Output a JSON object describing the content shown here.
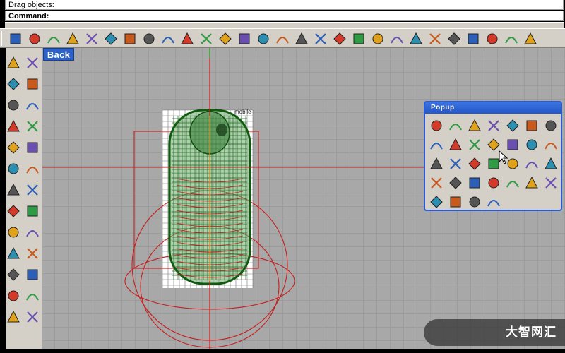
{
  "command_area": {
    "prompt_line": "Drag objects:",
    "command_label": "Command:"
  },
  "viewport": {
    "back_label": "Back",
    "model_label": "mobile-"
  },
  "popup": {
    "title": "Popup"
  },
  "watermark": {
    "text": "大智网汇"
  },
  "colors": {
    "viewport_bg": "#a8a8a8",
    "grid_line": "#9c9c9c",
    "wireframe": "#1f6b1f",
    "red_curve": "#c81e1e",
    "axis_green": "#2fae2f",
    "popup_title": "#2a5bd7"
  },
  "main_toolbar_icons": [
    "new-icon",
    "open-icon",
    "save-icon",
    "print-icon",
    "copy-icon",
    "cut-icon",
    "paste-icon",
    "clipboard-icon",
    "undo-icon",
    "pan-icon",
    "rotate-icon",
    "zoom-icon",
    "zoom-window-icon",
    "zoom-extents-icon",
    "zoom-selected-icon",
    "redo-view-icon",
    "four-viewports-icon",
    "car-icon",
    "grid-icon",
    "snap-icon",
    "points-icon",
    "light-icon",
    "lock-icon",
    "layer-icon",
    "color-wheel-icon",
    "sphere-wire-icon",
    "sphere-shaded-icon",
    "render-icon"
  ],
  "left_toolbar_icons": [
    "select-icon",
    "point-icon",
    "polyline-icon",
    "curve-icon",
    "circle-icon",
    "ellipse-icon",
    "arc-icon",
    "rectangle-icon",
    "polygon-icon",
    "spline-icon",
    "box-icon",
    "surface-icon",
    "solid-icon",
    "sweep-icon",
    "transform-icon",
    "explode-icon",
    "boolean-icon",
    "trim-icon",
    "fillet-icon",
    "offset-icon",
    "text-icon",
    "dimension-icon",
    "array-icon",
    "group-icon",
    "block-icon",
    "analyze-icon"
  ],
  "popup_icons": [
    "light-icon",
    "rect-icon",
    "arc-icon",
    "zoom-icon",
    "grid-sphere-icon",
    "sphere-icon",
    "color-wheel-icon",
    "explode-icon",
    "lightning-icon",
    "curve-icon",
    "polyline-icon",
    "walk-icon",
    "solid-icon",
    "sweep-icon",
    "points-icon",
    "diamond-icon",
    "surface-icon",
    "patch-icon",
    "cap-icon",
    "loft-icon",
    "sweep2-icon",
    "revolve-icon",
    "extrude-icon",
    "rail-icon",
    "network-icon",
    "split-icon",
    "cube-icon",
    "flatten-icon",
    "blend-icon",
    "match-icon",
    "merge-icon",
    "spiral-icon"
  ]
}
